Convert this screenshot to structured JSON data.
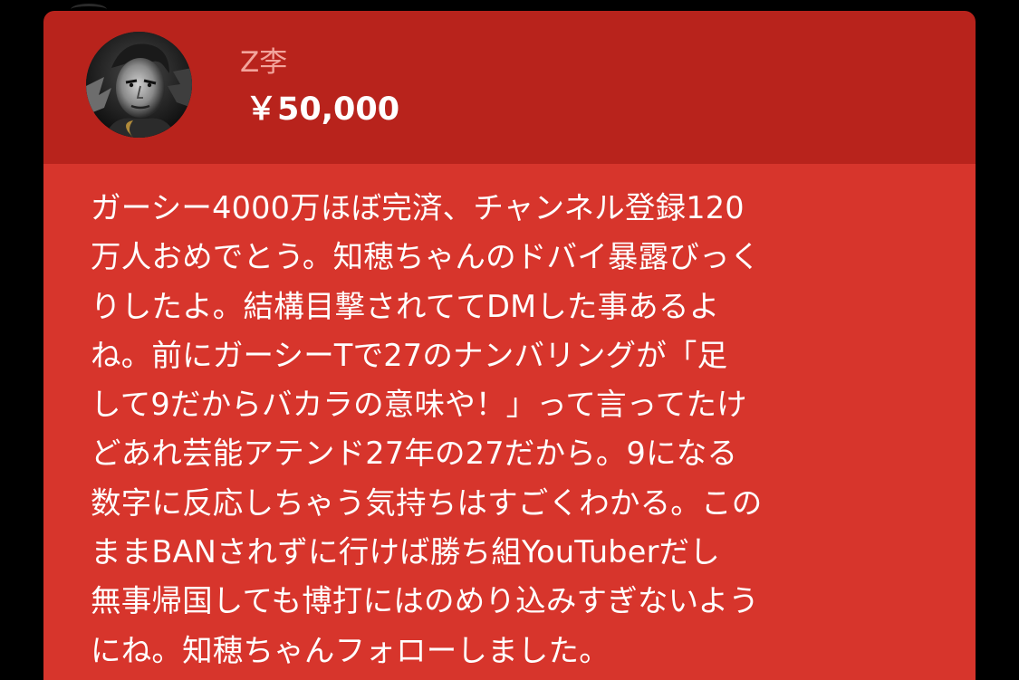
{
  "header": {
    "username": "Z李",
    "amount": "￥50,000"
  },
  "avatar": {
    "icon": "avatar-portrait-icon"
  },
  "message": {
    "text": "ガーシー4000万ほぼ完済、チャンネル登録120\n万人おめでとう。知穂ちゃんのドバイ暴露びっく\nりしたよ。結構目撃されててDMした事あるよ\nね。前にガーシーTで27のナンバリングが「足\nして9だからバカラの意味や！」って言ってたけ\nどあれ芸能アテンド27年の27だから。9になる\n数字に反応しちゃう気持ちはすごくわかる。この\nままBANされずに行けば勝ち組YouTuberだし\n無事帰国しても博打にはのめり込みすぎないよう\nにね。知穂ちゃんフォローしました。"
  },
  "colors": {
    "header_bg": "#b8231c",
    "body_bg": "#d7352c",
    "username": "#f2a49c",
    "text": "#ffffff",
    "page_bg": "#000000"
  }
}
